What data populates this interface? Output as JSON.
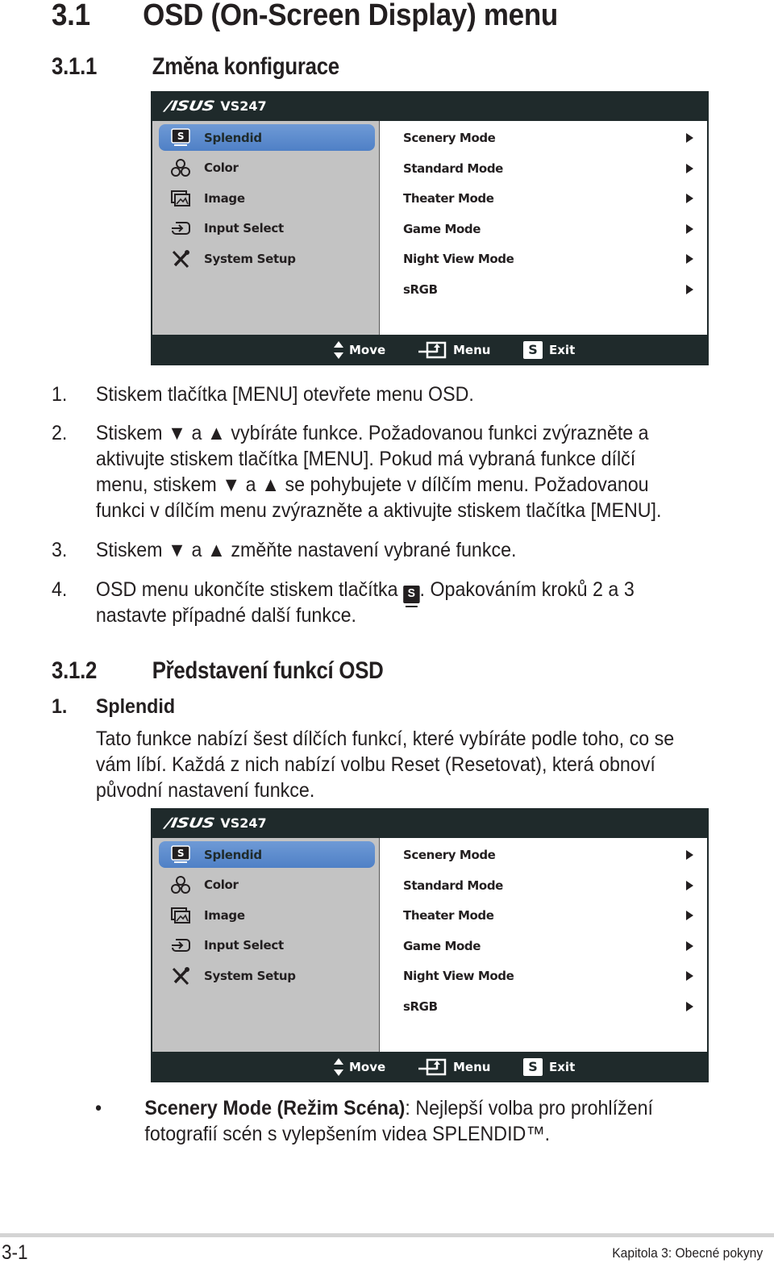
{
  "heading": {
    "number": "3.1",
    "title": "OSD (On-Screen Display) menu"
  },
  "section_1": {
    "number": "3.1.1",
    "title": "Změna konfigurace"
  },
  "osd": {
    "brand": "/ISUS",
    "model": "VS247",
    "menu": [
      {
        "label": "Splendid",
        "icon": "splendid-icon",
        "active": true
      },
      {
        "label": "Color",
        "icon": "color-rgb-icon",
        "active": false
      },
      {
        "label": "Image",
        "icon": "image-icon",
        "active": false
      },
      {
        "label": "Input Select",
        "icon": "input-select-icon",
        "active": false
      },
      {
        "label": "System Setup",
        "icon": "system-setup-icon",
        "active": false
      }
    ],
    "submenu": [
      {
        "label": "Scenery Mode"
      },
      {
        "label": "Standard Mode"
      },
      {
        "label": "Theater Mode"
      },
      {
        "label": "Game Mode"
      },
      {
        "label": "Night View Mode"
      },
      {
        "label": "sRGB"
      }
    ],
    "footer": {
      "move": "Move",
      "menu": "Menu",
      "exit": "Exit",
      "exit_key": "S"
    },
    "colors": {
      "frame": "#1f2a2b",
      "left_bg": "#c3c3c3",
      "active": "#5a88cb",
      "right_bg": "#ffffff"
    }
  },
  "steps": [
    {
      "n": "1.",
      "lines": [
        "Stiskem tlačítka [MENU] otevřete menu OSD."
      ]
    },
    {
      "n": "2.",
      "lines": [
        "Stiskem ▼ a ▲ vybíráte funkce. Požadovanou funkci zvýrazněte a",
        "aktivujte stiskem tlačítka [MENU]. Pokud má vybraná funkce dílčí",
        "menu, stiskem ▼ a ▲ se pohybujete v dílčím menu. Požadovanou",
        "funkci v dílčím menu zvýrazněte a aktivujte stiskem tlačítka [MENU]."
      ]
    },
    {
      "n": "3.",
      "lines": [
        "Stiskem ▼ a ▲ změňte nastavení vybrané funkce."
      ]
    },
    {
      "n": "4.",
      "line1_before": "OSD menu ukončíte stiskem tlačítka",
      "line1_key": "S",
      "line1_after": ". Opakováním kroků 2 a 3",
      "line2": "nastavte případné další funkce."
    }
  ],
  "section_2": {
    "number": "3.1.2",
    "title": "Představení funkcí OSD"
  },
  "splendid": {
    "n": "1.",
    "title": "Splendid",
    "lines": [
      "Tato funkce nabízí šest dílčích funkcí, které vybíráte podle toho, co se",
      "vám líbí. Každá z nich nabízí volbu Reset (Resetovat), která obnoví",
      "původní nastavení funkce."
    ]
  },
  "bullet": {
    "symbol": "•",
    "bold": "Scenery Mode (Režim Scéna)",
    "rest1": ": Nejlepší volba pro prohlížení",
    "line2": "fotografií scén s vylepšením videa SPLENDID™."
  },
  "footer": {
    "page": "3-1",
    "chapter": "Kapitola 3: Obecné pokyny"
  }
}
